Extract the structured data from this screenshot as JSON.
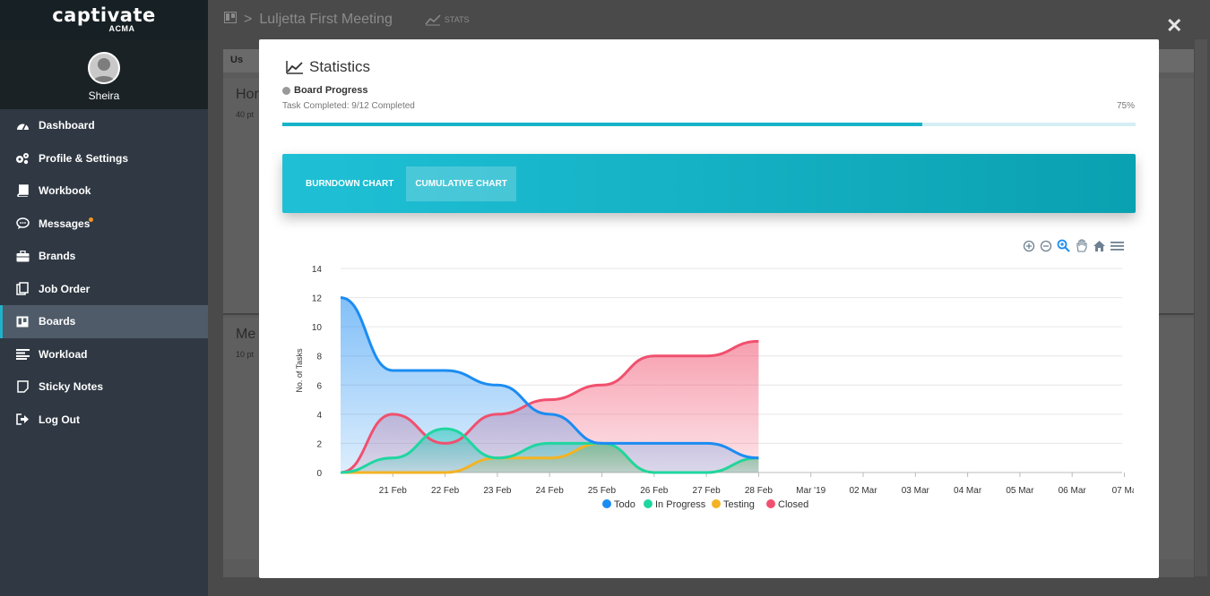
{
  "app": {
    "logo": "captivate",
    "logo_sub": "ACMA",
    "user_name": "Sheira"
  },
  "sidebar": {
    "items": [
      {
        "label": "Dashboard",
        "icon": "dashboard-icon"
      },
      {
        "label": "Profile & Settings",
        "icon": "gears-icon"
      },
      {
        "label": "Workbook",
        "icon": "book-icon"
      },
      {
        "label": "Messages",
        "icon": "chat-icon",
        "badge": true
      },
      {
        "label": "Brands",
        "icon": "briefcase-icon"
      },
      {
        "label": "Job Order",
        "icon": "clipboard-icon"
      },
      {
        "label": "Boards",
        "icon": "board-icon",
        "active": true
      },
      {
        "label": "Workload",
        "icon": "lines-icon"
      },
      {
        "label": "Sticky Notes",
        "icon": "note-icon"
      },
      {
        "label": "Log Out",
        "icon": "logout-icon"
      }
    ]
  },
  "topbar": {
    "breadcrumb_sep": ">",
    "board_title": "Luljetta First Meeting",
    "stats_label": "STATS"
  },
  "background": {
    "col1_label": "Hor",
    "col1_sub": "40 pt",
    "col2_label": "Me",
    "col2_sub": "10 pt",
    "tab_label": "Us"
  },
  "modal": {
    "title": "Statistics",
    "progress_title": "Board Progress",
    "progress_sub": "Task Completed: 9/12 Completed",
    "progress_pct_label": "75%",
    "progress_value": 0.75,
    "tabs": [
      {
        "label": "BURNDOWN CHART",
        "active": false
      },
      {
        "label": "CUMULATIVE CHART",
        "active": true
      }
    ],
    "toolbar_icons": [
      "zoom-in-icon",
      "zoom-out-icon",
      "zoom-select-icon",
      "pan-icon",
      "home-icon",
      "menu-icon"
    ]
  },
  "colors": {
    "todo": "#1b8cf2",
    "in_progress": "#1fd6a0",
    "testing": "#f3b324",
    "closed": "#f0506e",
    "accent": "#16b3c9"
  },
  "chart_data": {
    "type": "area",
    "ylabel": "No. of Tasks",
    "xlabel": "",
    "ylim": [
      0,
      14
    ],
    "yticks": [
      0,
      2,
      4,
      6,
      8,
      10,
      12,
      14
    ],
    "categories": [
      "21 Feb",
      "22 Feb",
      "23 Feb",
      "24 Feb",
      "25 Feb",
      "26 Feb",
      "27 Feb",
      "28 Feb",
      "Mar '19",
      "02 Mar",
      "03 Mar",
      "04 Mar",
      "05 Mar",
      "06 Mar",
      "07 Ma"
    ],
    "x_points": [
      "20 Feb",
      "21 Feb",
      "22 Feb",
      "23 Feb",
      "24 Feb",
      "25 Feb",
      "26 Feb",
      "27 Feb",
      "28 Feb"
    ],
    "series": [
      {
        "name": "Todo",
        "values": [
          12,
          7,
          7,
          6,
          4,
          2,
          2,
          2,
          1
        ]
      },
      {
        "name": "In Progress",
        "values": [
          0,
          1,
          3,
          1,
          2,
          2,
          0,
          0,
          1
        ]
      },
      {
        "name": "Testing",
        "values": [
          0,
          0,
          0,
          1,
          1,
          2,
          0,
          0,
          1
        ]
      },
      {
        "name": "Closed",
        "values": [
          0,
          4,
          2,
          4,
          5,
          6,
          8,
          8,
          9
        ]
      }
    ],
    "legend_position": "bottom-center",
    "grid": true
  }
}
